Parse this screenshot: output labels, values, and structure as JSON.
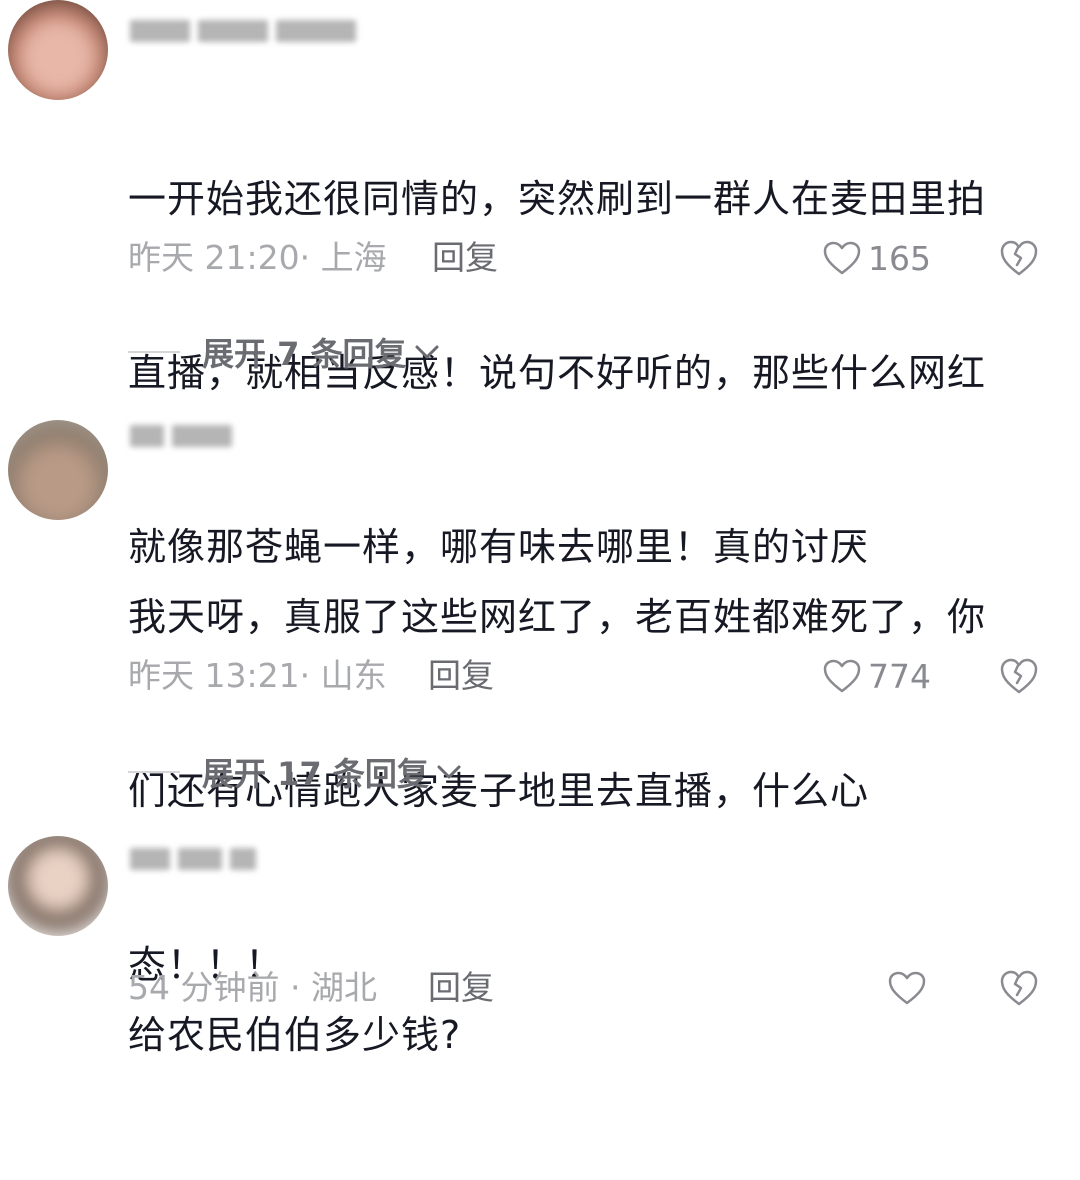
{
  "comments": [
    {
      "text": "一开始我还很同情的，突然刷到一群人在麦田里拍直播，就相当反感！说句不好听的，那些什么网红就像那苍蝇一样，哪有味去哪里！真的讨厌",
      "lines": [
        "一开始我还很同情的，突然刷到一群人在麦田里拍",
        "直播，就相当反感！说句不好听的，那些什么网红",
        "就像那苍蝇一样，哪有味去哪里！真的讨厌"
      ],
      "time": "昨天 21:20",
      "location": "上海",
      "meta": "昨天 21:20· 上海",
      "reply_label": "回复",
      "likes": "165",
      "expand_label": "展开 7 条回复"
    },
    {
      "text": "我天呀，真服了这些网红了，老百姓都难死了，你们还有心情跑人家麦子地里去直播，什么心态！！！",
      "lines": [
        "我天呀，真服了这些网红了，老百姓都难死了，你",
        "们还有心情跑人家麦子地里去直播，什么心",
        "态！！！"
      ],
      "time": "昨天 13:21",
      "location": "山东",
      "meta": "昨天 13:21· 山东",
      "reply_label": "回复",
      "likes": "774",
      "expand_label": "展开 17 条回复"
    },
    {
      "text": "给农民伯伯多少钱?",
      "lines": [
        "给农民伯伯多少钱?"
      ],
      "time": "54 分钟前",
      "location": "湖北",
      "meta": "54 分钟前 · 湖北",
      "reply_label": "回复",
      "likes": ""
    }
  ],
  "icons": {
    "like": "heart-outline-icon",
    "dislike": "broken-heart-icon",
    "expand": "chevron-down-icon"
  },
  "colors": {
    "text": "#161823",
    "meta": "#a8a9ad",
    "action": "#6b6c72"
  }
}
